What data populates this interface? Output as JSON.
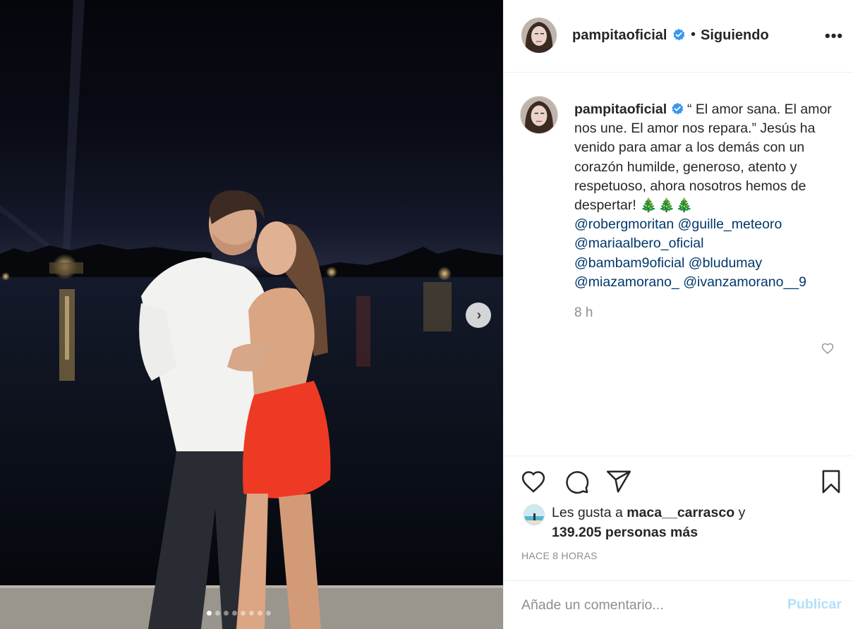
{
  "post": {
    "username": "pampitaoficial",
    "separator": "•",
    "follow_status": "Siguiendo",
    "more_label": "•••",
    "carousel": {
      "next_label": "›",
      "total_slides": 8,
      "active_index": 0
    }
  },
  "caption": {
    "username": "pampitaoficial",
    "text": "“ El amor sana. El amor nos une. El amor nos repara.” Jesús ha venido para amar a los demás con un corazón humilde, generoso, atento y respetuoso, ahora nosotros hemos de despertar!",
    "emoji": "🎄🎄🎄",
    "mentions": [
      "@robergmoritan",
      "@guille_meteoro",
      "@mariaalbero_oficial",
      "@bambam9oficial",
      "@bludumay",
      "@miazamorano_",
      "@ivanzamorano__9"
    ],
    "time": "8 h"
  },
  "likes": {
    "prefix": "Les gusta a",
    "user": "maca__carrasco",
    "conjunction": "y",
    "count": "139.205 personas más"
  },
  "timestamp": "HACE 8 HORAS",
  "comment": {
    "placeholder": "Añade un comentario...",
    "publish_label": "Publicar"
  },
  "colors": {
    "verified": "#3897f0",
    "mention": "#00376b",
    "publish_disabled": "#b2dffc",
    "muted": "#8e8e8e"
  },
  "icons": [
    "verified-icon",
    "more-icon",
    "heart-icon",
    "comment-icon",
    "share-icon",
    "bookmark-icon",
    "chevron-right-icon"
  ]
}
